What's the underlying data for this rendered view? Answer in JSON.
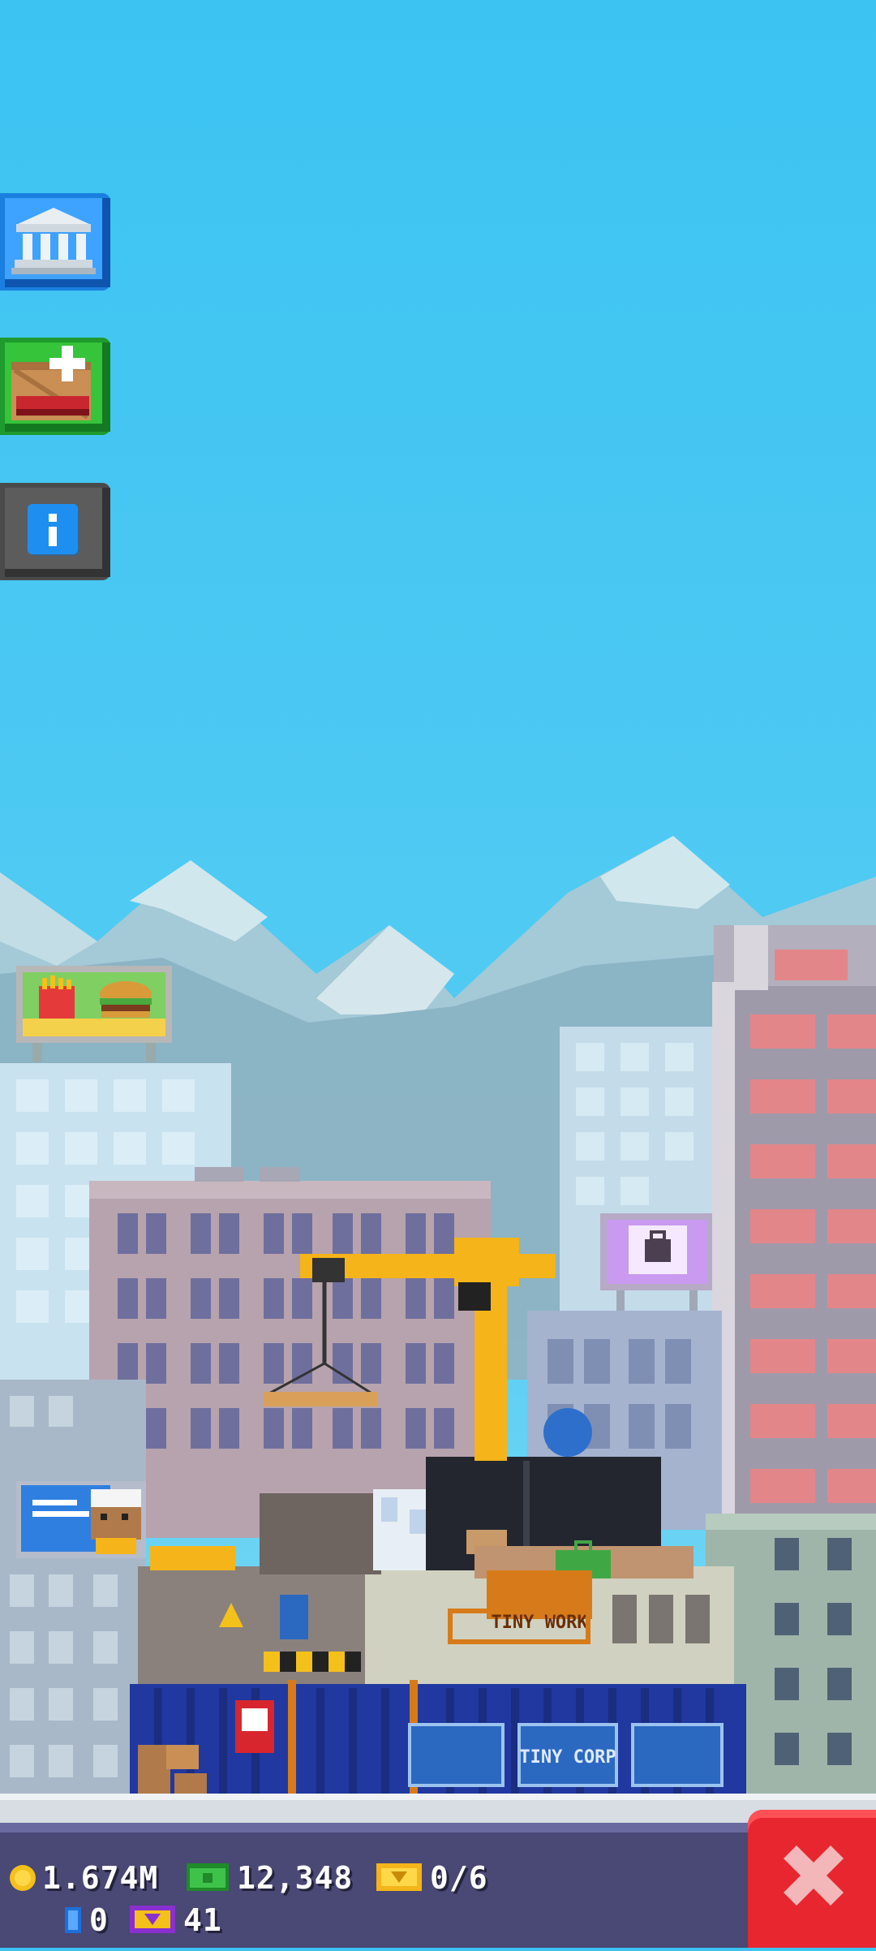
{
  "buttons": {
    "tower_button": "tower-icon",
    "store_button": "store-crate-icon",
    "info_button": "info-icon"
  },
  "status_bar": {
    "coins": "1.674M",
    "bux": "12,348",
    "vip_progress": "0/6",
    "tickets": "0",
    "tower_points": "41",
    "close_button": "close-icon"
  },
  "billboards": {
    "fast_food": "fries-burger-icon",
    "shop": "shopping-bag-icon",
    "ad": "chef-ad-icon"
  },
  "signs": {
    "construction_sign": "TINY WORK",
    "fence_sign": "TINY CORP"
  },
  "colors": {
    "sky": "#3cc3f2",
    "bottom_bar": "#4a4874",
    "close_button": "#e8262f",
    "crane": "#f4b41a"
  }
}
